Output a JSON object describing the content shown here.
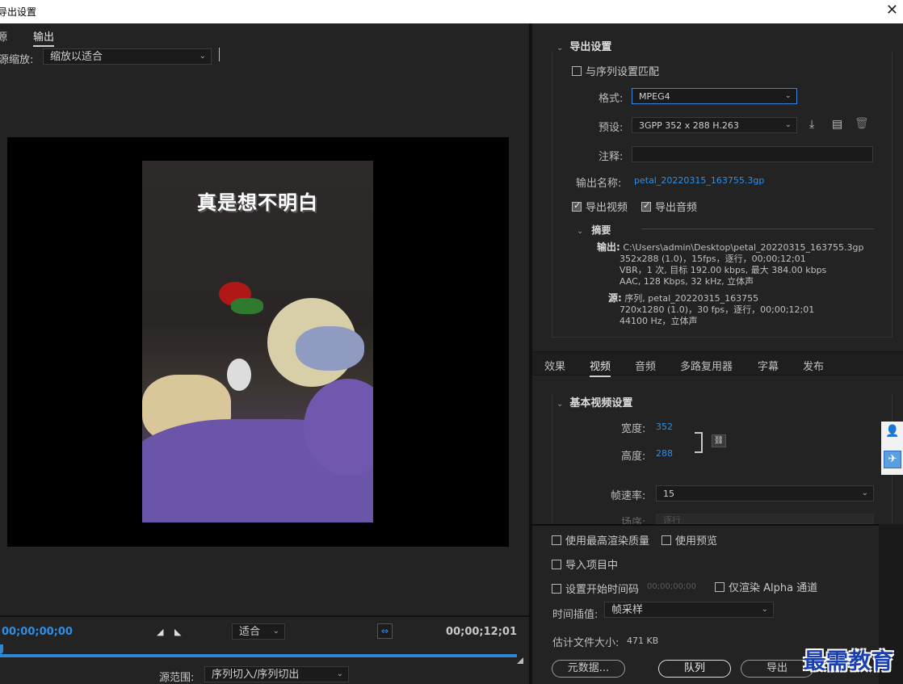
{
  "window": {
    "title": "导出设置",
    "close_icon": "close-icon"
  },
  "left": {
    "tabs": [
      {
        "label": "源"
      },
      {
        "label": "输出"
      }
    ],
    "source_scale_label": "源缩放:",
    "source_scale_value": "缩放以适合",
    "photo_caption": "真是想不明白",
    "timecode_current": "00;00;00;00",
    "timecode_end": "00;00;12;01",
    "fit_value": "适合",
    "source_range_label": "源范围:",
    "source_range_value": "序列切入/序列切出"
  },
  "export_settings": {
    "heading": "导出设置",
    "match_sequence": "与序列设置匹配",
    "format_label": "格式:",
    "format_value": "MPEG4",
    "preset_label": "预设:",
    "preset_value": "3GPP 352 x 288 H.263",
    "comment_label": "注释:",
    "output_name_label": "输出名称:",
    "output_name_value": "petal_20220315_163755.3gp",
    "export_video": "导出视频",
    "export_audio": "导出音频",
    "summary_heading": "摘要",
    "summary_output_key": "输出:",
    "summary_output_lines": [
      "C:\\Users\\admin\\Desktop\\petal_20220315_163755.3gp",
      "352x288 (1.0)，15fps，逐行，00;00;12;01",
      "VBR，1 次, 目标 192.00 kbps, 最大 384.00 kbps",
      "AAC, 128 Kbps, 32  kHz, 立体声"
    ],
    "summary_source_key": "源:",
    "summary_source_lines": [
      "序列, petal_20220315_163755",
      "720x1280 (1.0)，30 fps，逐行，00;00;12;01",
      "44100 Hz，立体声"
    ]
  },
  "tabs_right": [
    {
      "label": "效果"
    },
    {
      "label": "视频"
    },
    {
      "label": "音频"
    },
    {
      "label": "多路复用器"
    },
    {
      "label": "字幕"
    },
    {
      "label": "发布"
    }
  ],
  "video": {
    "heading": "基本视频设置",
    "width_label": "宽度:",
    "width_value": "352",
    "height_label": "高度:",
    "height_value": "288",
    "fps_label": "帧速率:",
    "fps_value": "15",
    "field_order_label": "场序:",
    "field_order_value": "逐行"
  },
  "bottom": {
    "max_render": "使用最高渲染质量",
    "use_previews": "使用预览",
    "import_project": "导入项目中",
    "set_start_tc": "设置开始时间码",
    "start_tc_value": "00;00;00;00",
    "alpha_only": "仅渲染 Alpha 通道",
    "interp_label": "时间插值:",
    "interp_value": "帧采样",
    "filesize_label": "估计文件大小:",
    "filesize_value": "471 KB",
    "metadata_btn": "元数据...",
    "queue_btn": "队列",
    "export_btn": "导出"
  },
  "watermark": "最需教育"
}
